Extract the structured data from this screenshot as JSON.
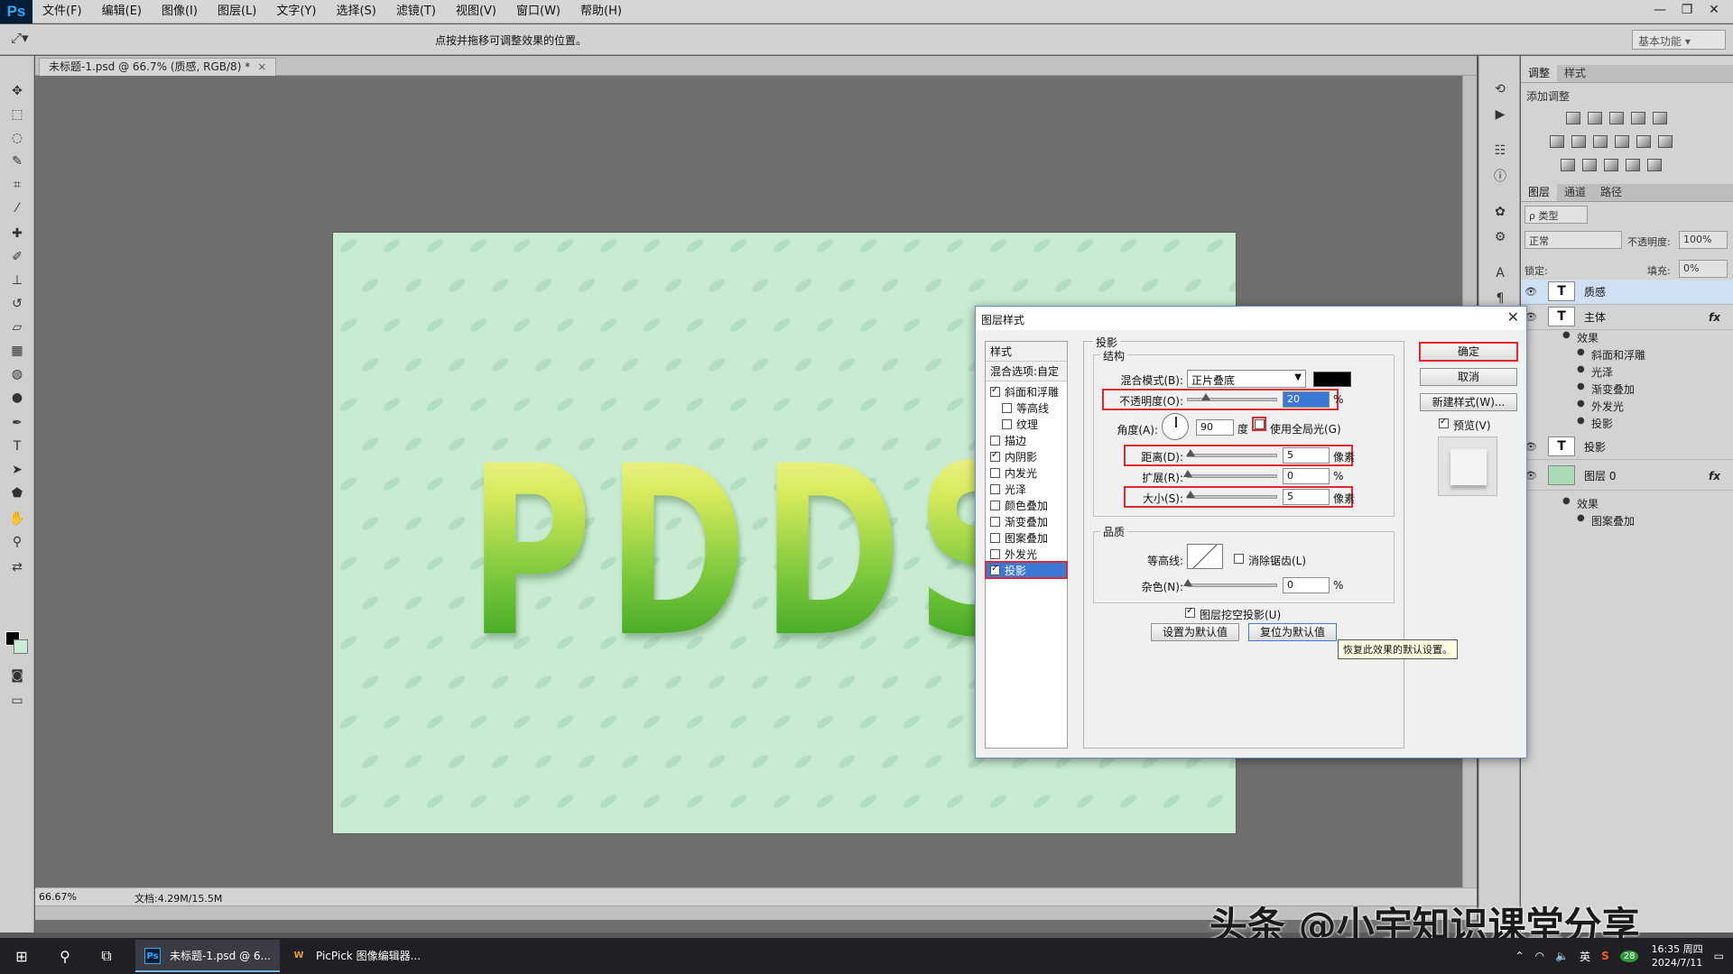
{
  "app": {
    "logo": "Ps",
    "brand_color": "#31a8ff"
  },
  "menu": [
    "文件(F)",
    "编辑(E)",
    "图像(I)",
    "图层(L)",
    "文字(Y)",
    "选择(S)",
    "滤镜(T)",
    "视图(V)",
    "窗口(W)",
    "帮助(H)"
  ],
  "window_controls": {
    "minimize": "—",
    "restore": "❐",
    "close": "✕"
  },
  "options_bar": {
    "hint": "点按并拖移可调整效果的位置。",
    "workspace": "基本功能"
  },
  "document": {
    "tab_title": "未标题-1.psd @ 66.7% (质感, RGB/8) *",
    "tab_close": "×",
    "zoom": "66.67%",
    "doc_size": "文档:4.29M/15.5M",
    "canvas_text": "PDDS"
  },
  "panels": {
    "adjust_tabs": [
      "调整",
      "样式"
    ],
    "adjust_title": "添加调整",
    "layer_tabs": [
      "图层",
      "通道",
      "路径"
    ],
    "filter_kind": "ρ 类型",
    "blend_mode": "正常",
    "opacity_label": "不透明度:",
    "opacity_value": "100%",
    "lock_label": "锁定:",
    "fill_label": "填充:",
    "fill_value": "0%",
    "layers": [
      {
        "name": "质感",
        "thumb": "T",
        "selected": true
      },
      {
        "name": "主体",
        "thumb": "T",
        "fx": "fx"
      },
      {
        "name": "投影",
        "thumb": "T"
      },
      {
        "name": "图层 0",
        "thumb": "",
        "fx": "fx"
      }
    ],
    "body_effects_label": "效果",
    "body_effects": [
      "斜面和浮雕",
      "光泽",
      "渐变叠加",
      "外发光",
      "投影"
    ],
    "layer0_effects_label": "效果",
    "layer0_effects": [
      "图案叠加"
    ]
  },
  "dialog": {
    "title": "图层样式",
    "close": "✕",
    "styles_header": "样式",
    "blend_options": "混合选项:自定",
    "styles": [
      {
        "label": "斜面和浮雕",
        "checked": true,
        "indent": false
      },
      {
        "label": "等高线",
        "checked": false,
        "indent": true
      },
      {
        "label": "纹理",
        "checked": false,
        "indent": true
      },
      {
        "label": "描边",
        "checked": false,
        "indent": false
      },
      {
        "label": "内阴影",
        "checked": true,
        "indent": false
      },
      {
        "label": "内发光",
        "checked": false,
        "indent": false
      },
      {
        "label": "光泽",
        "checked": false,
        "indent": false
      },
      {
        "label": "颜色叠加",
        "checked": false,
        "indent": false
      },
      {
        "label": "渐变叠加",
        "checked": false,
        "indent": false
      },
      {
        "label": "图案叠加",
        "checked": false,
        "indent": false
      },
      {
        "label": "外发光",
        "checked": false,
        "indent": false
      },
      {
        "label": "投影",
        "checked": true,
        "indent": false,
        "selected": true
      }
    ],
    "section": "投影",
    "structure": "结构",
    "blend_mode_label": "混合模式(B):",
    "blend_mode": "正片叠底",
    "shadow_color": "#000000",
    "opacity_label": "不透明度(O):",
    "opacity": "20",
    "opacity_fraction": 0.2,
    "angle_label": "角度(A):",
    "angle": "90",
    "angle_unit": "度",
    "global_light": "使用全局光(G)",
    "distance_label": "距离(D):",
    "distance": "5",
    "spread_label": "扩展(R):",
    "spread": "0",
    "size_label": "大小(S):",
    "size": "5",
    "unit_px": "像素",
    "unit_pct": "%",
    "quality": "品质",
    "contour_label": "等高线:",
    "antialias": "消除锯齿(L)",
    "noise_label": "杂色(N):",
    "noise": "0",
    "knockout": "图层挖空投影(U)",
    "set_default": "设置为默认值",
    "reset_default": "复位为默认值",
    "ok": "确定",
    "cancel": "取消",
    "new_style": "新建样式(W)...",
    "preview": "预览(V)",
    "tooltip": "恢复此效果的默认设置。"
  },
  "watermark": "头条 @小宇知识课堂分享",
  "taskbar": {
    "apps": [
      {
        "label": "未标题-1.psd @ 6...",
        "icon": "Ps",
        "active": true
      },
      {
        "label": "PicPick 图像编辑器...",
        "icon": "W",
        "active": false
      }
    ],
    "ime": "英",
    "badge": "28",
    "time": "16:35 周四",
    "date": "2024/7/11"
  },
  "colors": {
    "canvas_bg": "#c8ebd2",
    "text_green": "#3fa52a",
    "highlight_red": "#e0282f",
    "selection_blue": "#3b78d8"
  }
}
